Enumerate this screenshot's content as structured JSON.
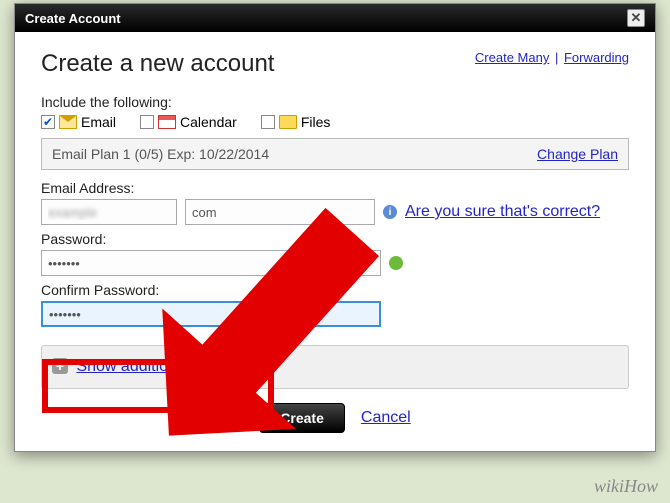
{
  "titlebar": {
    "title": "Create Account"
  },
  "header": {
    "title": "Create a new account",
    "links": {
      "create_many": "Create Many",
      "forwarding": "Forwarding"
    }
  },
  "include": {
    "label": "Include the following:",
    "email": "Email",
    "calendar": "Calendar",
    "files": "Files"
  },
  "plan": {
    "text": "Email Plan 1 (0/5) Exp: 10/22/2014",
    "change": "Change Plan"
  },
  "email": {
    "label": "Email Address:",
    "value_blur": "example",
    "domain": "com",
    "hint": "Are you sure that's correct?"
  },
  "password": {
    "label": "Password:",
    "value": "•••••••"
  },
  "confirm": {
    "label": "Confirm Password:",
    "value": "•••••••"
  },
  "options": {
    "show": "Show additional options"
  },
  "footer": {
    "create": "Create",
    "cancel": "Cancel"
  },
  "watermark": "wikiHow"
}
